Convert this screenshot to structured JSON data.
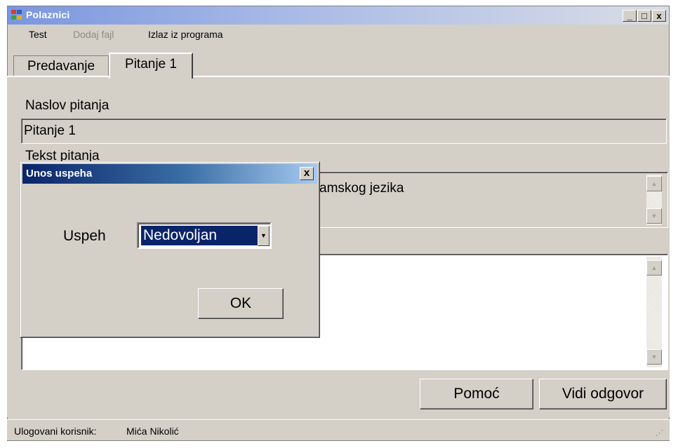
{
  "window": {
    "title": "Polaznici",
    "buttons": {
      "minimize": "_",
      "maximize": "□",
      "close": "x"
    }
  },
  "menu": [
    {
      "label": "Test",
      "enabled": true
    },
    {
      "label": "Dodaj fajl",
      "enabled": false
    },
    {
      "label": "Izlaz iz programa",
      "enabled": true
    }
  ],
  "tabs": [
    {
      "label": "Predavanje",
      "active": false
    },
    {
      "label": "Pitanje 1",
      "active": true
    }
  ],
  "form": {
    "title_label": "Naslov pitanja",
    "title_value": "Pitanje 1",
    "text_label": "Tekst pitanja",
    "text_value_visible": "amskog jezika",
    "help_button": "Pomoć",
    "answer_button": "Vidi odgovor"
  },
  "status": {
    "label": "Ulogovani korisnik:",
    "user": "Mića Nikolić"
  },
  "dialog": {
    "title": "Unos uspeha",
    "close": "x",
    "field_label": "Uspeh",
    "selected": "Nedovoljan",
    "ok": "OK"
  },
  "icons": {
    "scroll_up": "▲",
    "scroll_down": "▼",
    "dropdown": "▼"
  }
}
